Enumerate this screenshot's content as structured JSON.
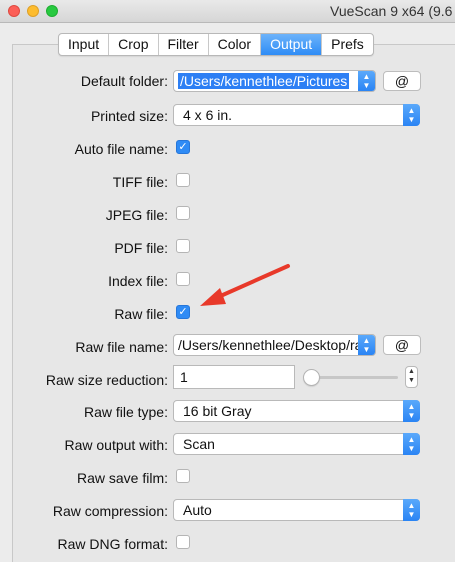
{
  "window": {
    "title": "VueScan 9 x64 (9.6"
  },
  "tabs": [
    {
      "label": "Input"
    },
    {
      "label": "Crop"
    },
    {
      "label": "Filter"
    },
    {
      "label": "Color"
    },
    {
      "label": "Output",
      "active": true
    },
    {
      "label": "Prefs"
    }
  ],
  "fields": {
    "default_folder": {
      "label": "Default folder:",
      "value": "/Users/kennethlee/Pictures",
      "button": "@"
    },
    "printed_size": {
      "label": "Printed size:",
      "value": "4 x 6 in."
    },
    "auto_file_name": {
      "label": "Auto file name:",
      "checked": true
    },
    "tiff_file": {
      "label": "TIFF file:",
      "checked": false
    },
    "jpeg_file": {
      "label": "JPEG file:",
      "checked": false
    },
    "pdf_file": {
      "label": "PDF file:",
      "checked": false
    },
    "index_file": {
      "label": "Index file:",
      "checked": false
    },
    "raw_file": {
      "label": "Raw file:",
      "checked": true
    },
    "raw_file_name": {
      "label": "Raw file name:",
      "value": "/Users/kennethlee/Desktop/ra",
      "button": "@"
    },
    "raw_size_reduction": {
      "label": "Raw size reduction:",
      "value": "1"
    },
    "raw_file_type": {
      "label": "Raw file type:",
      "value": "16 bit Gray"
    },
    "raw_output_with": {
      "label": "Raw output with:",
      "value": "Scan"
    },
    "raw_save_film": {
      "label": "Raw save film:",
      "checked": false
    },
    "raw_compression": {
      "label": "Raw compression:",
      "value": "Auto"
    },
    "raw_dng_format": {
      "label": "Raw DNG format:",
      "checked": false
    }
  },
  "annotation": {
    "color": "#e8392a"
  },
  "icons": {
    "check": "✓",
    "popup_arrows": "updown-chevron-icon"
  }
}
